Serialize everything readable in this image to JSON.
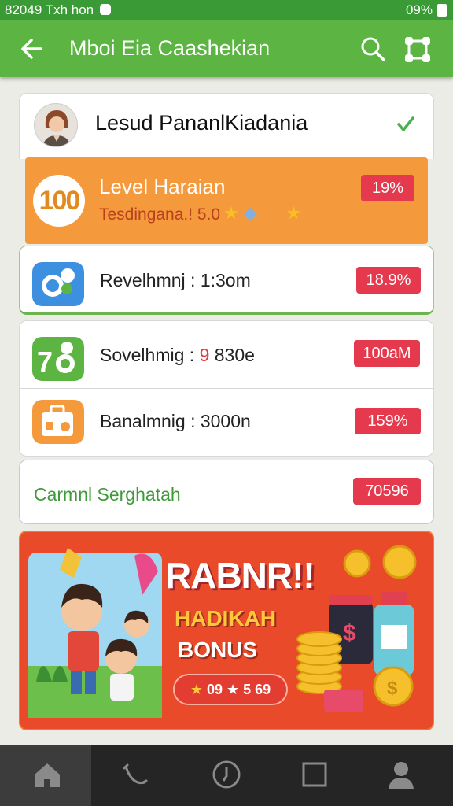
{
  "status_bar": {
    "time": "82049 Txh hon",
    "battery_text": "09%"
  },
  "app_bar": {
    "title": "Mboi Eia Caashekian",
    "back_icon": "arrow-left-icon",
    "search_icon": "search-icon",
    "share_icon": "share-nodes-icon"
  },
  "profile": {
    "name": "Lesud PananlKiadania",
    "avatar_icon": "user-avatar-icon",
    "check_icon": "check-icon"
  },
  "level_card": {
    "badge": "100",
    "title": "Level Haraian",
    "subtitle": "Tesdingana.! 5.0",
    "badge_value": "19%"
  },
  "rows": [
    {
      "label": "Revelhmnj : 1:3om",
      "label_plain": "Revelhmnj : 1:3om",
      "badge": "18.9%",
      "icon": "chat-bubble-icon"
    },
    {
      "label_pre": "Sovelhmig : ",
      "label_hl": "9",
      "label_post": " 830e",
      "badge": "100aM",
      "icon": "chat-refresh-icon"
    },
    {
      "label": "Banalmnig : 3000n",
      "badge": "159%",
      "icon": "briefcase-icon"
    }
  ],
  "carmin": {
    "label": "Carmnl Serghatah",
    "badge": "70596"
  },
  "banner": {
    "headline": "RABNR!!",
    "line1": "HADIKAH",
    "line2": "BONUS",
    "chip": "09 ★ 5 69",
    "chip_prefix": "★"
  },
  "bottom_nav": [
    "home-icon",
    "route-icon",
    "clock-icon",
    "square-icon",
    "profile-icon"
  ],
  "colors": {
    "green": "#5cb443",
    "orange": "#f49a3c",
    "red_pill": "#e5394d",
    "banner": "#e84a2a"
  }
}
